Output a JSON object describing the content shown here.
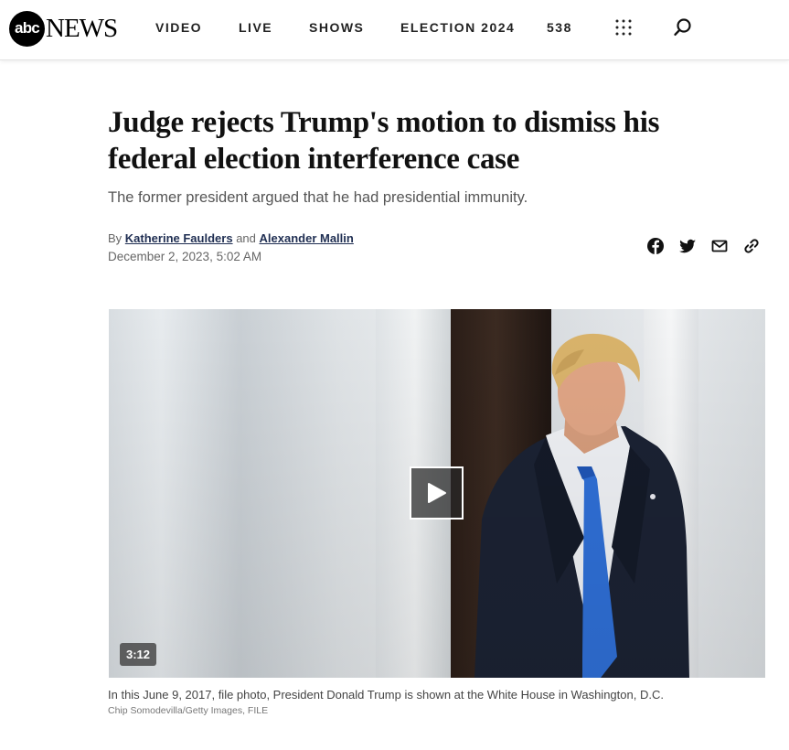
{
  "header": {
    "logo_mark": "abc",
    "logo_word": "NEWS",
    "nav": [
      "VIDEO",
      "LIVE",
      "SHOWS",
      "ELECTION 2024",
      "538"
    ],
    "menu_icon": "grid-dots-icon",
    "search_icon": "search-icon"
  },
  "article": {
    "headline": "Judge rejects Trump's motion to dismiss his federal election interference case",
    "dek": "The former president argued that he had presidential immunity.",
    "byline": {
      "prefix": "By",
      "author1": "Katherine Faulders",
      "joiner": "and",
      "author2": "Alexander Mallin"
    },
    "date": "December 2, 2023, 5:02 AM",
    "share_icons": [
      "facebook-icon",
      "twitter-icon",
      "email-icon",
      "link-icon"
    ]
  },
  "media": {
    "duration": "3:12",
    "caption": "In this June 9, 2017, file photo, President Donald Trump is shown at the White House in Washington, D.C.",
    "credit": "Chip Somodevilla/Getty Images, FILE"
  },
  "colors": {
    "byline_link": "#1f2e52",
    "text_muted": "#666666",
    "tie_blue": "#2f6fd6"
  }
}
